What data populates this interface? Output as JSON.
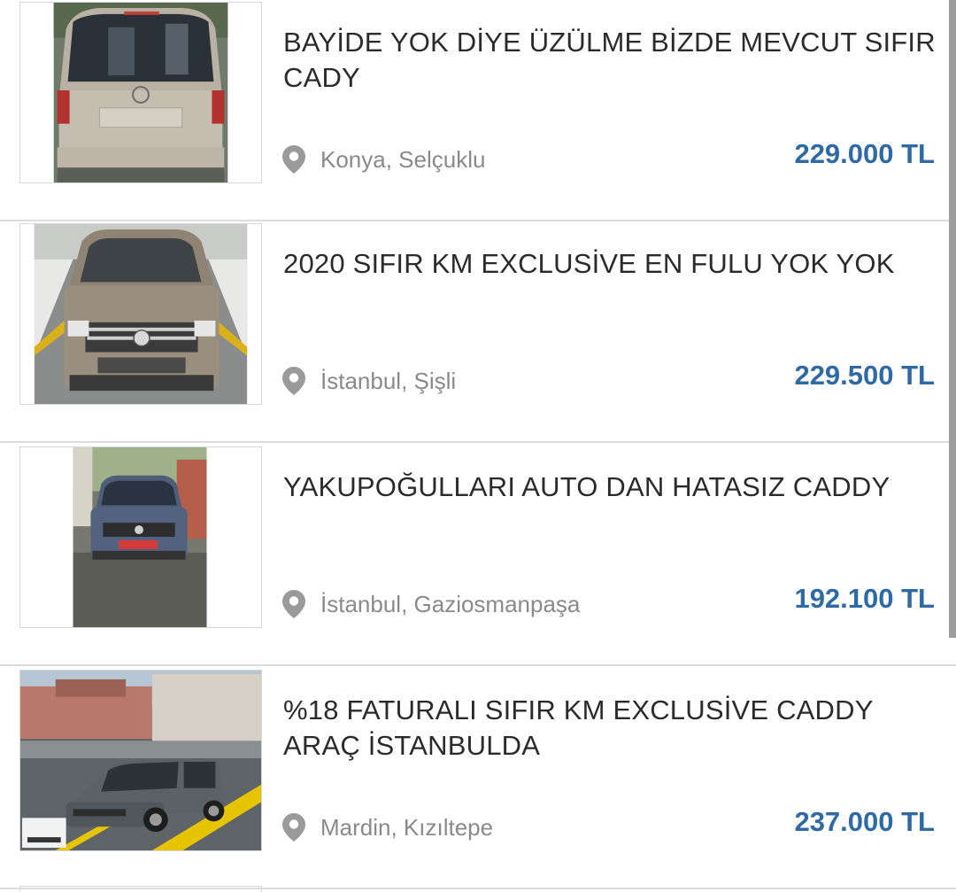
{
  "listings": [
    {
      "title": "BAYİDE YOK DİYE ÜZÜLME BİZDE MEVCUT SIFIR CADY",
      "location": "Konya, Selçuklu",
      "price": "229.000 TL",
      "image_icon": "car-photo-rear-view"
    },
    {
      "title": "2020 SIFIR KM EXCLUSİVE EN FULU YOK YOK",
      "location": "İstanbul, Şişli",
      "price": "229.500 TL",
      "image_icon": "car-photo-front-view"
    },
    {
      "title": "YAKUPOĞULLARI AUTO DAN HATASIZ CADDY",
      "location": "İstanbul, Gaziosmanpaşa",
      "price": "192.100 TL",
      "image_icon": "car-photo-front-street"
    },
    {
      "title": "%18 FATURALI SIFIR KM EXCLUSİVE CADDY ARAÇ İSTANBULDA",
      "location": "Mardin, Kızıltepe",
      "price": "237.000 TL",
      "image_icon": "car-photo-side-view"
    }
  ],
  "colors": {
    "price": "#2f6aa7",
    "title": "#2b2b2b",
    "location": "#8a8a8a",
    "divider": "#dcdcdc",
    "pin_icon": "#9a9a9a"
  },
  "icons": {
    "location": "map-pin-icon"
  }
}
